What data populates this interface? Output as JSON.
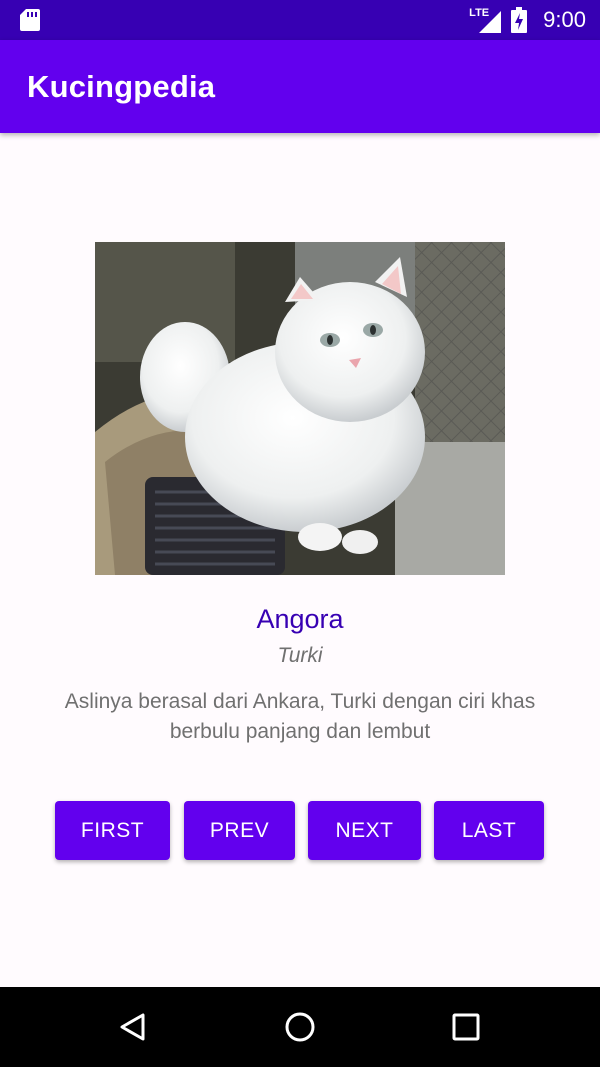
{
  "status_bar": {
    "network": "LTE",
    "time": "9:00",
    "icons": [
      "sd-card-icon",
      "signal-icon",
      "battery-charging-icon"
    ]
  },
  "app_bar": {
    "title": "Kucingpedia"
  },
  "cat": {
    "image_subject": "white long-haired cat",
    "name": "Angora",
    "origin": "Turki",
    "description": "Aslinya berasal dari Ankara, Turki dengan ciri khas berbulu panjang dan lembut"
  },
  "buttons": {
    "first": "FIRST",
    "prev": "PREV",
    "next": "NEXT",
    "last": "LAST"
  },
  "nav_bar": {
    "icons": [
      "back-icon",
      "home-icon",
      "recents-icon"
    ]
  },
  "colors": {
    "status_bar": "#3700b3",
    "primary": "#6200ee",
    "name_text": "#3700b3",
    "secondary_text": "#707070"
  }
}
